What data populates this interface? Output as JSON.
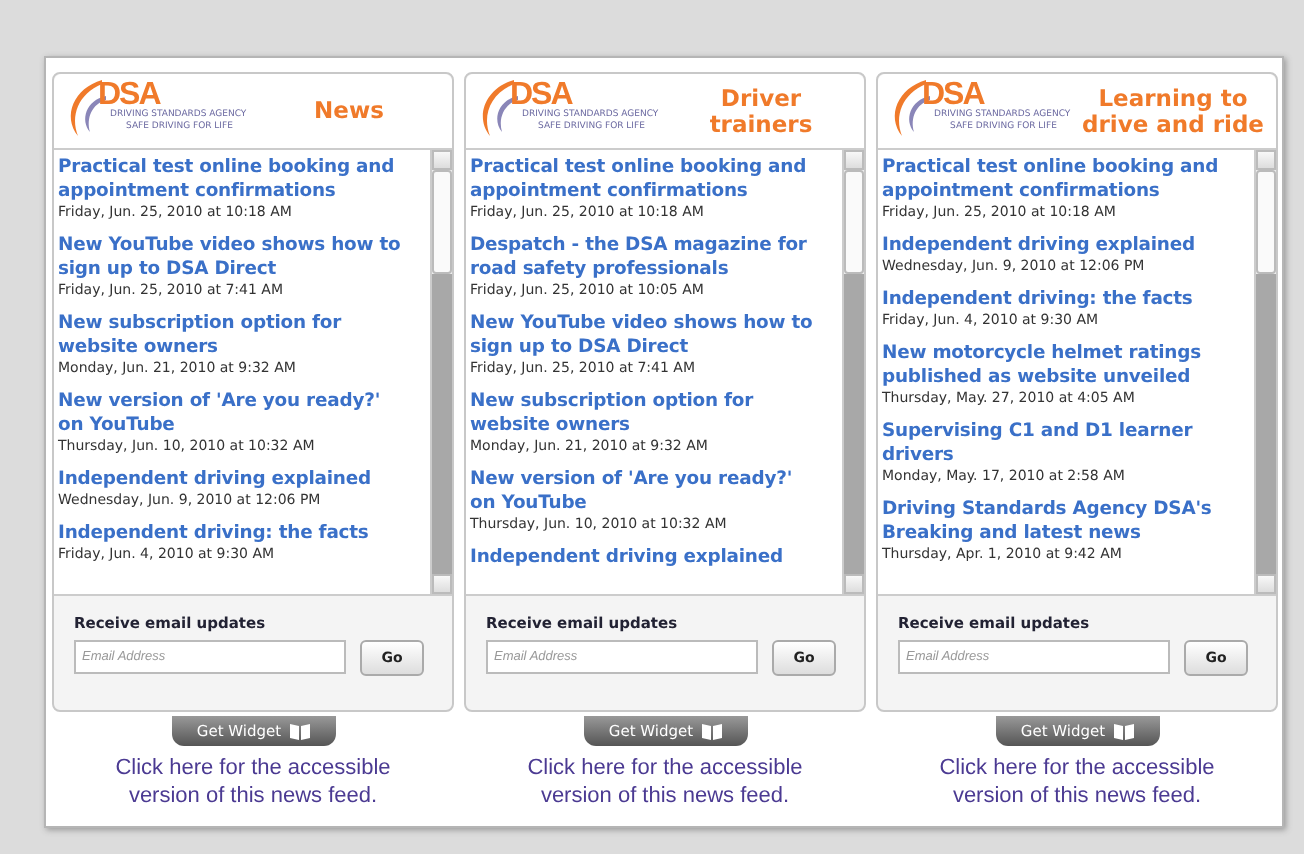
{
  "widgets": [
    {
      "logo": {
        "mark": "DSA",
        "agency": "DRIVING STANDARDS AGENCY",
        "tagline": "SAFE DRIVING FOR LIFE"
      },
      "title": "News",
      "items": [
        {
          "headline": "Practical test online booking and appointment confirmations",
          "date": "Friday, Jun. 25, 2010 at 10:18 AM"
        },
        {
          "headline": "New YouTube video shows how to sign up to DSA Direct",
          "date": "Friday, Jun. 25, 2010 at 7:41 AM"
        },
        {
          "headline": "New subscription option for website owners",
          "date": "Monday, Jun. 21, 2010 at 9:32 AM"
        },
        {
          "headline": "New version of 'Are you ready?' on YouTube",
          "date": "Thursday, Jun. 10, 2010 at 10:32 AM"
        },
        {
          "headline": "Independent driving explained",
          "date": "Wednesday, Jun. 9, 2010 at 12:06 PM"
        },
        {
          "headline": "Independent driving: the facts",
          "date": "Friday, Jun. 4, 2010 at 9:30 AM"
        }
      ],
      "email": {
        "label": "Receive email updates",
        "placeholder": "Email Address",
        "button": "Go"
      },
      "widget_button": "Get Widget",
      "accessible_link": "Click here for the accessible version of this news feed."
    },
    {
      "logo": {
        "mark": "DSA",
        "agency": "DRIVING STANDARDS AGENCY",
        "tagline": "SAFE DRIVING FOR LIFE"
      },
      "title": "Driver trainers",
      "items": [
        {
          "headline": "Practical test online booking and appointment confirmations",
          "date": "Friday, Jun. 25, 2010 at 10:18 AM"
        },
        {
          "headline": "Despatch - the DSA magazine for road safety professionals",
          "date": "Friday, Jun. 25, 2010 at 10:05 AM"
        },
        {
          "headline": "New YouTube video shows how to sign up to DSA Direct",
          "date": "Friday, Jun. 25, 2010 at 7:41 AM"
        },
        {
          "headline": "New subscription option for website owners",
          "date": "Monday, Jun. 21, 2010 at 9:32 AM"
        },
        {
          "headline": "New version of 'Are you ready?' on YouTube",
          "date": "Thursday, Jun. 10, 2010 at 10:32 AM"
        },
        {
          "headline": "Independent driving explained"
        }
      ],
      "email": {
        "label": "Receive email updates",
        "placeholder": "Email Address",
        "button": "Go"
      },
      "widget_button": "Get Widget",
      "accessible_link": "Click here for the accessible version of this news feed."
    },
    {
      "logo": {
        "mark": "DSA",
        "agency": "DRIVING STANDARDS AGENCY",
        "tagline": "SAFE DRIVING FOR LIFE"
      },
      "title": "Learning to drive and ride",
      "items": [
        {
          "headline": "Practical test online booking and appointment confirmations",
          "date": "Friday, Jun. 25, 2010 at 10:18 AM"
        },
        {
          "headline": "Independent driving explained",
          "date": "Wednesday, Jun. 9, 2010 at 12:06 PM"
        },
        {
          "headline": "Independent driving: the facts",
          "date": "Friday, Jun. 4, 2010 at 9:30 AM"
        },
        {
          "headline": "New motorcycle helmet ratings published as website unveiled",
          "date": "Thursday, May. 27, 2010 at 4:05 AM"
        },
        {
          "headline": "Supervising C1 and D1 learner drivers",
          "date": "Monday, May. 17, 2010 at 2:58 AM"
        },
        {
          "headline": "Driving Standards Agency DSA's Breaking and latest news",
          "date": "Thursday, Apr. 1, 2010 at 9:42 AM"
        }
      ],
      "email": {
        "label": "Receive email updates",
        "placeholder": "Email Address",
        "button": "Go"
      },
      "widget_button": "Get Widget",
      "accessible_link": "Click here for the accessible version of this news feed."
    }
  ]
}
